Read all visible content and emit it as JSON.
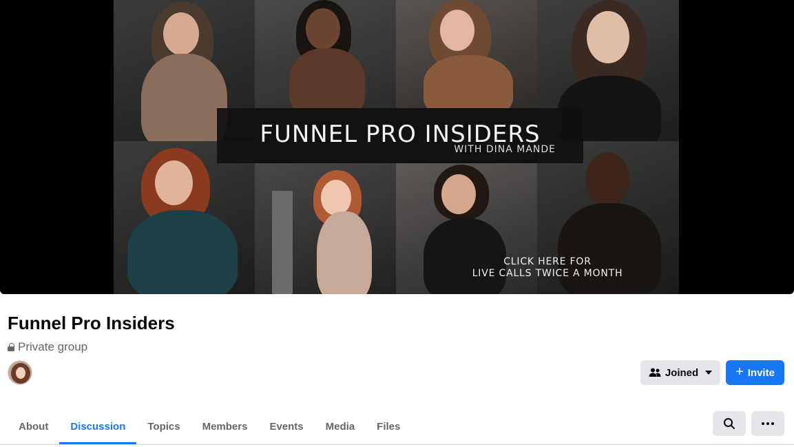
{
  "cover": {
    "title": "FUNNEL PRO INSIDERS",
    "subtitle": "WITH DINA MANDE",
    "cta_line1": "CLICK HERE FOR",
    "cta_line2": "LIVE CALLS TWICE A MONTH"
  },
  "group": {
    "name": "Funnel Pro Insiders",
    "privacy": "Private group"
  },
  "actions": {
    "joined_label": "Joined",
    "invite_label": "Invite",
    "invite_symbol": "+"
  },
  "tabs": [
    {
      "label": "About"
    },
    {
      "label": "Discussion"
    },
    {
      "label": "Topics"
    },
    {
      "label": "Members"
    },
    {
      "label": "Events"
    },
    {
      "label": "Media"
    },
    {
      "label": "Files"
    }
  ],
  "active_tab": "Discussion",
  "colors": {
    "accent": "#1877f2",
    "button_gray": "#e4e6eb",
    "secondary_text": "#65676b"
  },
  "icons": [
    "lock-icon",
    "people-icon",
    "caret-down-icon",
    "plus-icon",
    "search-icon",
    "more-icon"
  ]
}
